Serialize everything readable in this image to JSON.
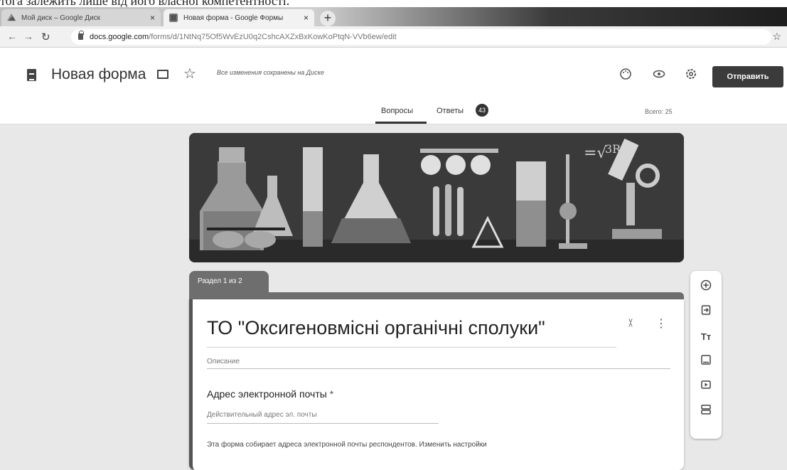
{
  "doc_strip_text": "тога залежить лише від його власної компетентності.",
  "browser": {
    "tabs": [
      {
        "label": "Мой диск – Google Диск",
        "close": "×"
      },
      {
        "label": "Новая форма - Google Формы",
        "close": "×"
      }
    ],
    "new_tab": "+",
    "url_host": "docs.google.com",
    "url_path": "/forms/d/1NtNq75Of5WvEzU0q2CshcAXZxBxKowKoPtqN-VVb6ew/edit"
  },
  "header": {
    "form_title": "Новая форма",
    "saved_status": "Все изменения сохранены на Диске",
    "send_label": "Отправить",
    "tabs": {
      "questions": "Вопросы",
      "responses": "Ответы",
      "responses_count": "43"
    },
    "total": "Всего: 25"
  },
  "section": {
    "tag": "Раздел 1 из 2",
    "title": "ТО \"Оксигеновмісні органічні сполуки\"",
    "description_placeholder": "Описание"
  },
  "email_question": {
    "label": "Адрес электронной почты",
    "required_mark": "*",
    "placeholder": "Действительный адрес эл. почты",
    "note": "Эта форма собирает адреса электронной почты респондентов.",
    "note_link": "Изменить настройки"
  },
  "icons": [
    "palette-icon",
    "preview-icon",
    "settings-icon",
    "add-question-icon",
    "import-questions-icon",
    "add-title-icon",
    "add-image-icon",
    "add-video-icon",
    "add-section-icon"
  ]
}
